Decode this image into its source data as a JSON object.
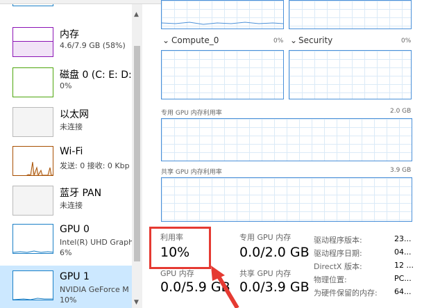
{
  "sidebar": {
    "items": [
      {
        "title": "内存",
        "sub": "4.6/7.9 GB (58%)"
      },
      {
        "title": "磁盘 0 (C: E: D:",
        "sub": "0%"
      },
      {
        "title": "以太网",
        "sub": "未连接"
      },
      {
        "title": "Wi-Fi",
        "sub": "发送: 0 接收: 0 Kbp"
      },
      {
        "title": "蓝牙 PAN",
        "sub": "未连接"
      },
      {
        "title": "GPU 0",
        "sub": "Intel(R) UHD Graph",
        "sub2": "6%"
      },
      {
        "title": "GPU 1",
        "sub": "NVIDIA GeForce M",
        "sub2": "10%"
      }
    ]
  },
  "graphs": {
    "compute_label": "Compute_0",
    "compute_pct": "0%",
    "security_label": "Security",
    "security_pct": "0%",
    "dedicated_label": "专用 GPU 内存利用率",
    "dedicated_max": "2.0 GB",
    "shared_label": "共享 GPU 内存利用率",
    "shared_max": "3.9 GB"
  },
  "stats": {
    "util_label": "利用率",
    "util_value": "10%",
    "dedicated_label": "专用 GPU 内存",
    "dedicated_value": "0.0/2.0 GB",
    "gpu_mem_label": "GPU 内存",
    "gpu_mem_value": "0.0/5.9 GB",
    "shared_label": "共享 GPU 内存",
    "shared_value": "0.0/3.9 GB"
  },
  "properties": [
    {
      "label": "驱动程序版本:",
      "value": "23..."
    },
    {
      "label": "驱动程序日期:",
      "value": "04..."
    },
    {
      "label": "DirectX 版本:",
      "value": "12 ..."
    },
    {
      "label": "物理位置:",
      "value": "PC..."
    },
    {
      "label": "为硬件保留的内存:",
      "value": "64..."
    }
  ],
  "colors": {
    "accent_highlight": "#e53a32",
    "graph_border": "#4a90d9",
    "selected": "#cce8ff"
  }
}
